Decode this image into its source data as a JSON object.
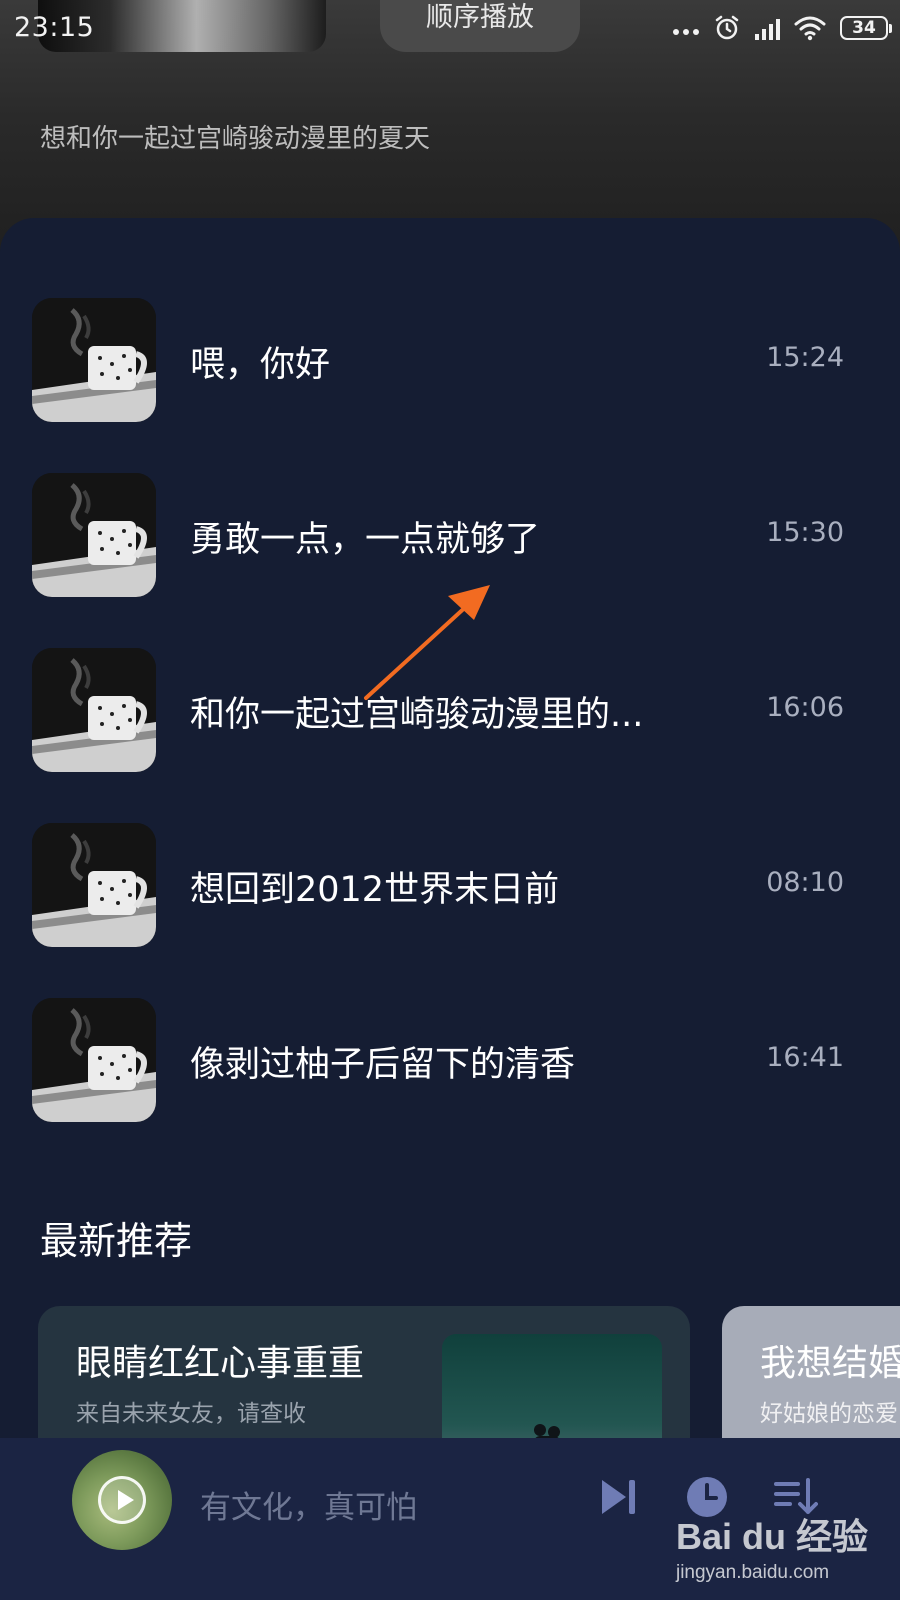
{
  "status_bar": {
    "time": "23:15",
    "battery": "34",
    "icons": [
      "more-dots-icon",
      "alarm-icon",
      "signal-icon",
      "wifi-icon",
      "battery-icon"
    ]
  },
  "header": {
    "play_mode": "顺序播放",
    "subtitle": "想和你一起过宫崎骏动漫里的夏天"
  },
  "episodes": [
    {
      "title": "喂，你好",
      "duration": "15:24"
    },
    {
      "title": "勇敢一点，一点就够了",
      "duration": "15:30"
    },
    {
      "title": "和你一起过宫崎骏动漫里的...",
      "duration": "16:06"
    },
    {
      "title": "想回到2012世界末日前",
      "duration": "08:10"
    },
    {
      "title": "像剥过柚子后留下的清香",
      "duration": "16:41"
    }
  ],
  "recommend": {
    "title": "最新推荐",
    "cards": [
      {
        "title": "眼睛红红心事重重",
        "subtitle": "来自未来女友，请查收"
      },
      {
        "title": "我想结婚",
        "subtitle": "好姑娘的恋爱"
      }
    ]
  },
  "player": {
    "now_playing": "有文化，真可怕",
    "buttons": [
      "next-icon",
      "timer-icon",
      "playlist-icon"
    ]
  },
  "watermark": {
    "logo": "Bai du 经验",
    "url": "jingyan.baidu.com"
  },
  "colors": {
    "panel_bg": "#151d33",
    "player_bg": "#1b2443",
    "annotation_arrow": "#f26b21"
  }
}
